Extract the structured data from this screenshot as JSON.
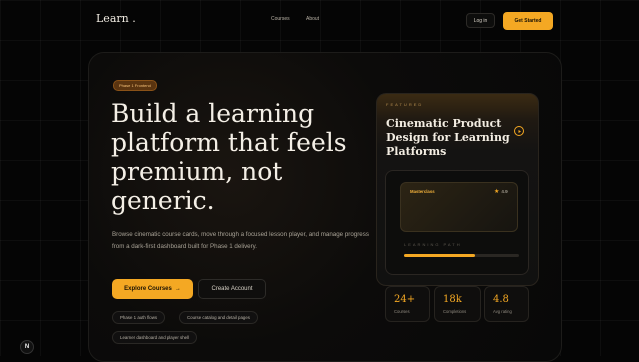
{
  "nav": {
    "logo": "Learn .",
    "links": [
      "Courses",
      "About"
    ],
    "login": "Log in",
    "get_started": "Get Started"
  },
  "hero": {
    "badge": "Phase 1 Frontend",
    "headline": "Build a learning platform that feels premium, not generic.",
    "subtext": "Browse cinematic course cards, move through a focused lesson player, and manage progress from a dark-first dashboard built for Phase 1 delivery.",
    "explore_label": "Explore Courses",
    "explore_arrow": "→",
    "create_label": "Create Account",
    "chips": [
      "Phase 1 auth flows",
      "Course catalog and detail pages",
      "Learner dashboard and player shell"
    ]
  },
  "featured": {
    "label": "FEATURED",
    "title": "Cinematic Product Design for Learning Platforms",
    "tag": "Masterclass",
    "rating": "4.9",
    "path_label": "LEARNING PATH",
    "progress": 0.62
  },
  "stats": [
    {
      "value": "24+",
      "label": "Courses"
    },
    {
      "value": "18k",
      "label": "Completions"
    },
    {
      "value": "4.8",
      "label": "Avg rating"
    }
  ],
  "colors": {
    "accent": "#f4a823",
    "background": "#050505"
  },
  "icons": {
    "play": "play-circle-icon",
    "star": "star-icon",
    "arrow": "arrow-right-icon"
  },
  "corner_badge": "N"
}
